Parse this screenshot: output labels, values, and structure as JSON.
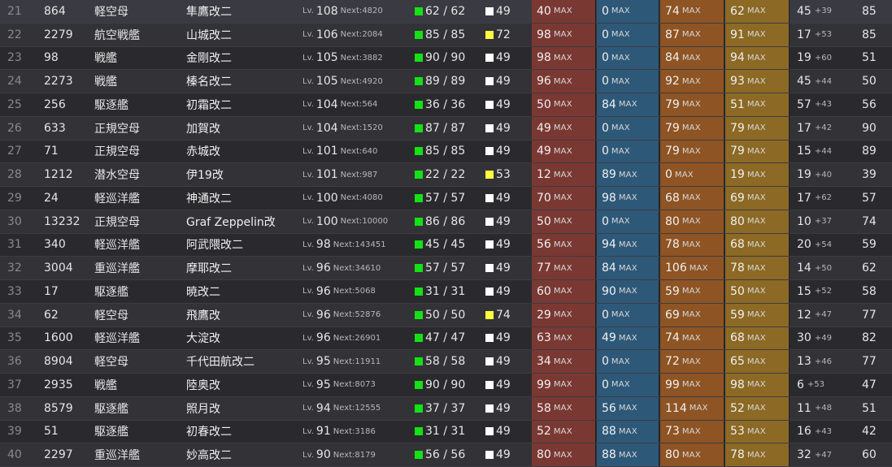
{
  "labels": {
    "lv": "Lv.",
    "next": "Next:",
    "max": "MAX"
  },
  "colors": {
    "hp_square": "#16e016",
    "cond_white": "#ffffff",
    "cond_yellow": "#ffff40",
    "firepower": "#7a3833",
    "torpedo": "#2e5878",
    "antiair": "#8e5424",
    "armor": "#8c6924"
  },
  "rows": [
    {
      "idx": "21",
      "id": "864",
      "type": "軽空母",
      "name": "隼鷹改二",
      "lv": "108",
      "next": "4820",
      "hp": "62 / 62",
      "cond_color": "white",
      "cond": "49",
      "fp": "40",
      "tp": "0",
      "aa": "74",
      "ar": "62",
      "luck": "45",
      "luck_bonus": "+39",
      "last": "85"
    },
    {
      "idx": "22",
      "id": "2279",
      "type": "航空戦艦",
      "name": "山城改二",
      "lv": "106",
      "next": "2084",
      "hp": "85 / 85",
      "cond_color": "yellow",
      "cond": "72",
      "fp": "98",
      "tp": "0",
      "aa": "87",
      "ar": "91",
      "luck": "17",
      "luck_bonus": "+53",
      "last": "85"
    },
    {
      "idx": "23",
      "id": "98",
      "type": "戦艦",
      "name": "金剛改二",
      "lv": "105",
      "next": "3882",
      "hp": "90 / 90",
      "cond_color": "white",
      "cond": "49",
      "fp": "98",
      "tp": "0",
      "aa": "84",
      "ar": "94",
      "luck": "19",
      "luck_bonus": "+60",
      "last": "51"
    },
    {
      "idx": "24",
      "id": "2273",
      "type": "戦艦",
      "name": "榛名改二",
      "lv": "105",
      "next": "4920",
      "hp": "89 / 89",
      "cond_color": "white",
      "cond": "49",
      "fp": "96",
      "tp": "0",
      "aa": "92",
      "ar": "93",
      "luck": "45",
      "luck_bonus": "+44",
      "last": "50"
    },
    {
      "idx": "25",
      "id": "256",
      "type": "駆逐艦",
      "name": "初霜改二",
      "lv": "104",
      "next": "564",
      "hp": "36 / 36",
      "cond_color": "white",
      "cond": "49",
      "fp": "50",
      "tp": "84",
      "aa": "79",
      "ar": "51",
      "luck": "57",
      "luck_bonus": "+43",
      "last": "56"
    },
    {
      "idx": "26",
      "id": "633",
      "type": "正規空母",
      "name": "加賀改",
      "lv": "104",
      "next": "1520",
      "hp": "87 / 87",
      "cond_color": "white",
      "cond": "49",
      "fp": "49",
      "tp": "0",
      "aa": "79",
      "ar": "79",
      "luck": "17",
      "luck_bonus": "+42",
      "last": "90"
    },
    {
      "idx": "27",
      "id": "71",
      "type": "正規空母",
      "name": "赤城改",
      "lv": "101",
      "next": "640",
      "hp": "85 / 85",
      "cond_color": "white",
      "cond": "49",
      "fp": "49",
      "tp": "0",
      "aa": "79",
      "ar": "79",
      "luck": "15",
      "luck_bonus": "+44",
      "last": "89"
    },
    {
      "idx": "28",
      "id": "1212",
      "type": "潜水空母",
      "name": "伊19改",
      "lv": "101",
      "next": "987",
      "hp": "22 / 22",
      "cond_color": "yellow",
      "cond": "53",
      "fp": "12",
      "tp": "89",
      "aa": "0",
      "ar": "19",
      "luck": "19",
      "luck_bonus": "+40",
      "last": "39"
    },
    {
      "idx": "29",
      "id": "24",
      "type": "軽巡洋艦",
      "name": "神通改二",
      "lv": "100",
      "next": "4080",
      "hp": "57 / 57",
      "cond_color": "white",
      "cond": "49",
      "fp": "70",
      "tp": "98",
      "aa": "68",
      "ar": "69",
      "luck": "17",
      "luck_bonus": "+62",
      "last": "57"
    },
    {
      "idx": "30",
      "id": "13232",
      "type": "正規空母",
      "name": "Graf Zeppelin改",
      "lv": "100",
      "next": "10000",
      "hp": "86 / 86",
      "cond_color": "white",
      "cond": "49",
      "fp": "50",
      "tp": "0",
      "aa": "80",
      "ar": "80",
      "luck": "10",
      "luck_bonus": "+37",
      "last": "74"
    },
    {
      "idx": "31",
      "id": "340",
      "type": "軽巡洋艦",
      "name": "阿武隈改二",
      "lv": "98",
      "next": "143451",
      "hp": "45 / 45",
      "cond_color": "white",
      "cond": "49",
      "fp": "56",
      "tp": "94",
      "aa": "78",
      "ar": "68",
      "luck": "20",
      "luck_bonus": "+54",
      "last": "59"
    },
    {
      "idx": "32",
      "id": "3004",
      "type": "重巡洋艦",
      "name": "摩耶改二",
      "lv": "96",
      "next": "34610",
      "hp": "57 / 57",
      "cond_color": "white",
      "cond": "49",
      "fp": "77",
      "tp": "84",
      "aa": "106",
      "ar": "78",
      "luck": "14",
      "luck_bonus": "+50",
      "last": "62"
    },
    {
      "idx": "33",
      "id": "17",
      "type": "駆逐艦",
      "name": "暁改二",
      "lv": "96",
      "next": "5068",
      "hp": "31 / 31",
      "cond_color": "white",
      "cond": "49",
      "fp": "60",
      "tp": "90",
      "aa": "59",
      "ar": "50",
      "luck": "15",
      "luck_bonus": "+52",
      "last": "58"
    },
    {
      "idx": "34",
      "id": "62",
      "type": "軽空母",
      "name": "飛鷹改",
      "lv": "96",
      "next": "52876",
      "hp": "50 / 50",
      "cond_color": "yellow",
      "cond": "74",
      "fp": "29",
      "tp": "0",
      "aa": "69",
      "ar": "59",
      "luck": "12",
      "luck_bonus": "+47",
      "last": "77"
    },
    {
      "idx": "35",
      "id": "1600",
      "type": "軽巡洋艦",
      "name": "大淀改",
      "lv": "96",
      "next": "26901",
      "hp": "47 / 47",
      "cond_color": "white",
      "cond": "49",
      "fp": "63",
      "tp": "49",
      "aa": "74",
      "ar": "68",
      "luck": "30",
      "luck_bonus": "+49",
      "last": "82"
    },
    {
      "idx": "36",
      "id": "8904",
      "type": "軽空母",
      "name": "千代田航改二",
      "lv": "95",
      "next": "11911",
      "hp": "58 / 58",
      "cond_color": "white",
      "cond": "49",
      "fp": "34",
      "tp": "0",
      "aa": "72",
      "ar": "65",
      "luck": "13",
      "luck_bonus": "+46",
      "last": "77"
    },
    {
      "idx": "37",
      "id": "2935",
      "type": "戦艦",
      "name": "陸奥改",
      "lv": "95",
      "next": "8073",
      "hp": "90 / 90",
      "cond_color": "white",
      "cond": "49",
      "fp": "99",
      "tp": "0",
      "aa": "99",
      "ar": "98",
      "luck": "6",
      "luck_bonus": "+53",
      "last": "47"
    },
    {
      "idx": "38",
      "id": "8579",
      "type": "駆逐艦",
      "name": "照月改",
      "lv": "94",
      "next": "12555",
      "hp": "37 / 37",
      "cond_color": "white",
      "cond": "49",
      "fp": "58",
      "tp": "56",
      "aa": "114",
      "ar": "52",
      "luck": "11",
      "luck_bonus": "+48",
      "last": "51"
    },
    {
      "idx": "39",
      "id": "51",
      "type": "駆逐艦",
      "name": "初春改二",
      "lv": "91",
      "next": "3186",
      "hp": "31 / 31",
      "cond_color": "white",
      "cond": "49",
      "fp": "52",
      "tp": "88",
      "aa": "73",
      "ar": "53",
      "luck": "16",
      "luck_bonus": "+43",
      "last": "42"
    },
    {
      "idx": "40",
      "id": "2297",
      "type": "重巡洋艦",
      "name": "妙高改二",
      "lv": "90",
      "next": "8179",
      "hp": "56 / 56",
      "cond_color": "white",
      "cond": "49",
      "fp": "80",
      "tp": "88",
      "aa": "80",
      "ar": "78",
      "luck": "32",
      "luck_bonus": "+47",
      "last": "60"
    }
  ]
}
